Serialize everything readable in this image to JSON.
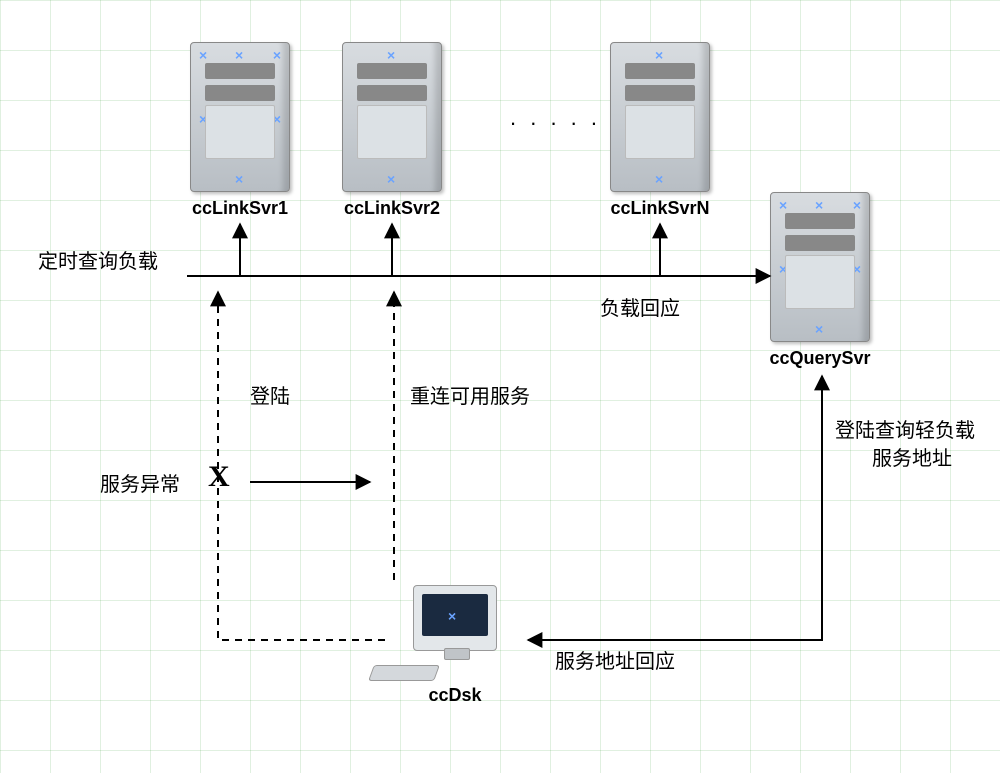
{
  "servers": {
    "link1": {
      "label": "ccLinkSvr1"
    },
    "link2": {
      "label": "ccLinkSvr2"
    },
    "linkN": {
      "label": "ccLinkSvrN"
    },
    "query": {
      "label": "ccQuerySvr"
    }
  },
  "client": {
    "label": "ccDsk"
  },
  "text": {
    "poll_load": "定时查询负载",
    "load_reply": "负载回应",
    "login": "登陆",
    "reconnect": "重连可用服务",
    "service_fail": "服务异常",
    "query_light_load_line1": "登陆查询轻负载",
    "query_light_load_line2": "服务地址",
    "addr_reply": "服务地址回应"
  },
  "ellipsis": ". . . . . . ."
}
